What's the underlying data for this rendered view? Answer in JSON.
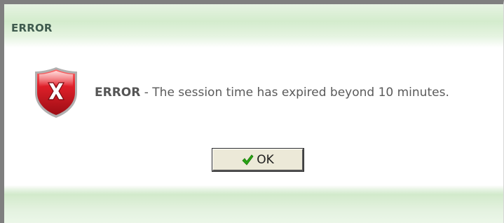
{
  "dialog": {
    "title": "ERROR",
    "icon": "error-shield-x-icon",
    "message_bold": "ERROR",
    "message_text": " - The session time has expired beyond 10 minutes.",
    "ok_button": {
      "label": "OK",
      "icon": "green-check-icon"
    }
  },
  "colors": {
    "header_green": "#d4eccd",
    "title_text": "#3f5b4e",
    "error_red": "#c8102e",
    "check_green": "#2aa515",
    "button_face": "#ece9d8"
  }
}
